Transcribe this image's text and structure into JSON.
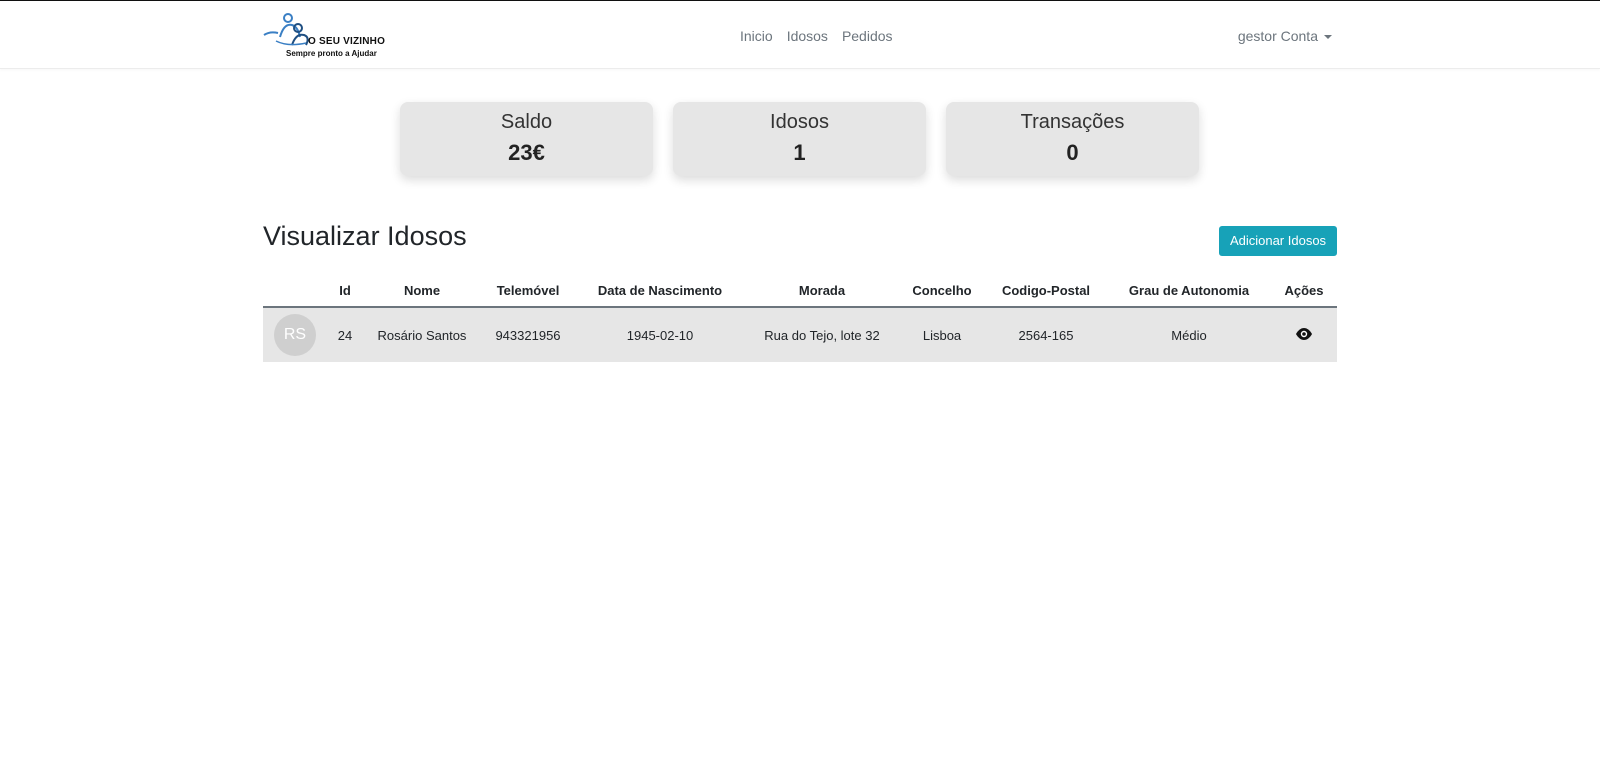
{
  "app": {
    "brand_name": "O SEU VIZINHO",
    "brand_tagline": "Sempre pronto a Ajudar",
    "colors": {
      "accent": "#17a2b8",
      "card_bg": "#e6e6e6",
      "row_bg": "#e6e6e6",
      "logo_blue": "#3a7fc4"
    }
  },
  "nav": {
    "links": [
      {
        "label": "Inicio"
      },
      {
        "label": "Idosos"
      },
      {
        "label": "Pedidos"
      }
    ],
    "user_menu": {
      "label": "gestor Conta",
      "icon": "caret-down-icon"
    }
  },
  "stats": [
    {
      "label": "Saldo",
      "value": "23€"
    },
    {
      "label": "Idosos",
      "value": "1"
    },
    {
      "label": "Transações",
      "value": "0"
    }
  ],
  "main": {
    "title": "Visualizar Idosos",
    "add_button": "Adicionar Idosos"
  },
  "table": {
    "columns": [
      "",
      "Id",
      "Nome",
      "Telemóvel",
      "Data de Nascimento",
      "Morada",
      "Concelho",
      "Codigo-Postal",
      "Grau de Autonomia",
      "Ações"
    ],
    "rows": [
      {
        "avatar": "RS",
        "id": "24",
        "nome": "Rosário Santos",
        "telemovel": "943321956",
        "nascimento": "1945-02-10",
        "morada": "Rua do Tejo, lote 32",
        "concelho": "Lisboa",
        "codigo_postal": "2564-165",
        "autonomia": "Médio",
        "action_icon": "eye-icon"
      }
    ]
  }
}
